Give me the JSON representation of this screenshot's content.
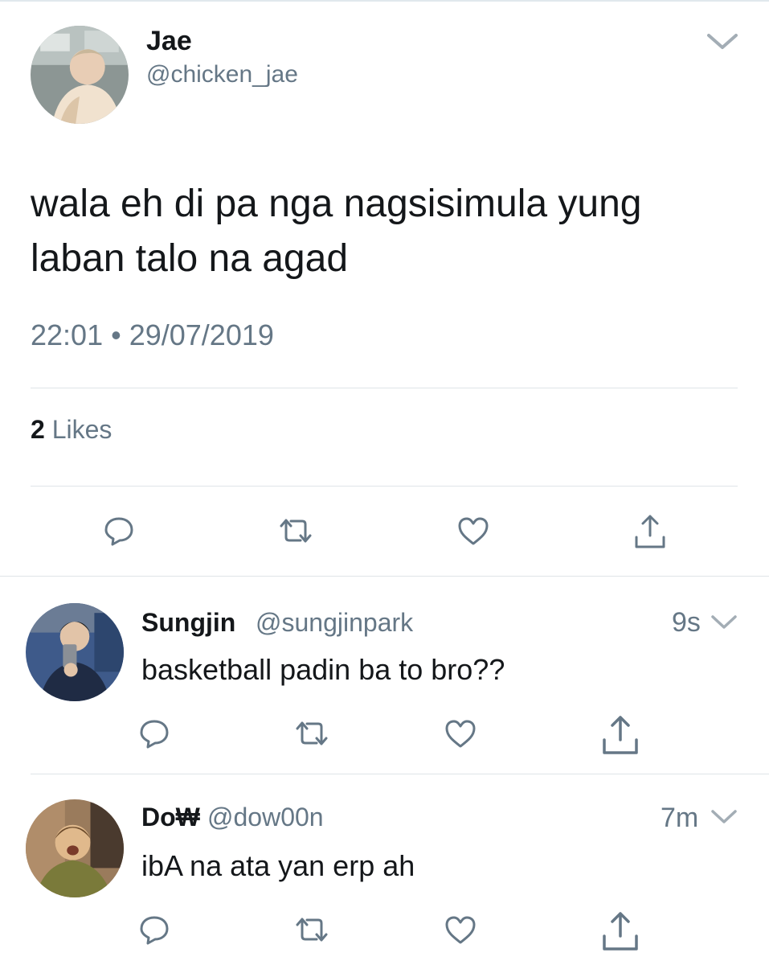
{
  "main_tweet": {
    "author_name": "Jae",
    "author_handle": "@chicken_jae",
    "text": "wala eh di pa nga nagsisimula yung laban talo na agad",
    "time": "22:01",
    "date": "29/07/2019",
    "likes_count": "2",
    "likes_label": "Likes"
  },
  "replies": [
    {
      "author_name": "Sungjin",
      "author_handle": "@sungjinpark",
      "time_ago": "9s",
      "text": "basketball padin ba to bro??"
    },
    {
      "author_name": "Do₩",
      "author_handle": "@dow00n",
      "time_ago": "7m",
      "text": "ibA na ata yan erp ah"
    }
  ],
  "icons": {
    "reply": "reply-icon",
    "retweet": "retweet-icon",
    "like": "heart-icon",
    "share": "share-icon",
    "more": "chevron-down-icon"
  },
  "colors": {
    "text": "#14171a",
    "secondary": "#657786",
    "divider": "#dfe4e8"
  }
}
